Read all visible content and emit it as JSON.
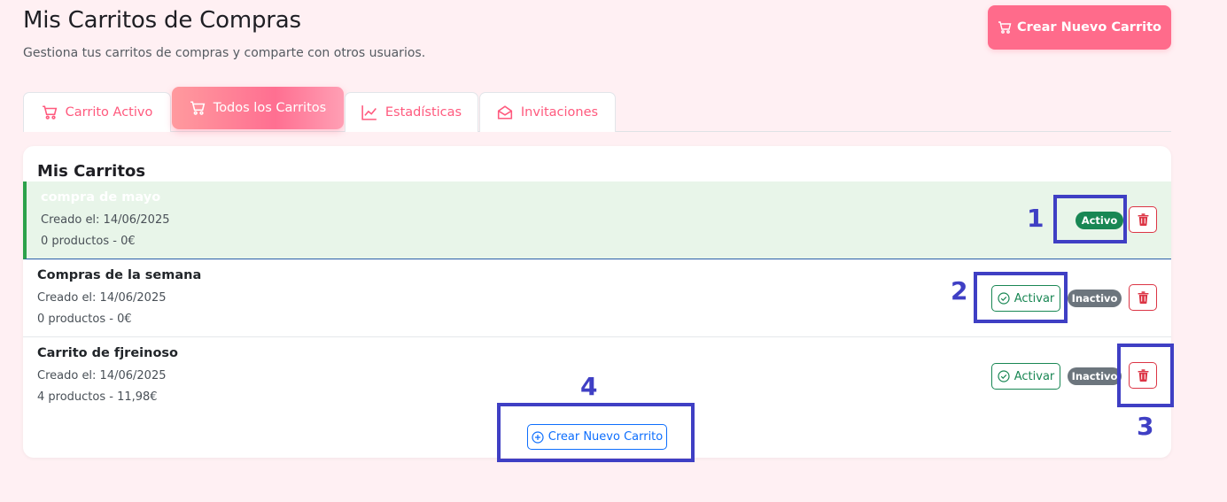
{
  "header": {
    "title": "Mis Carritos de Compras",
    "subtitle": "Gestiona tus carritos de compras y comparte con otros usuarios.",
    "create_button": "Crear Nuevo Carrito"
  },
  "tabs": [
    {
      "label": "Carrito Activo",
      "icon": "cart-icon"
    },
    {
      "label": "Todos los Carritos",
      "icon": "cart-icon",
      "active": true
    },
    {
      "label": "Estadísticas",
      "icon": "chart-line-icon"
    },
    {
      "label": "Invitaciones",
      "icon": "envelope-icon"
    }
  ],
  "card": {
    "title": "Mis Carritos",
    "carts": [
      {
        "name": "compra de mayo",
        "created": "Creado el: 14/06/2025",
        "summary": "0 productos - 0€",
        "status": "Activo",
        "is_active": true
      },
      {
        "name": "Compras de la semana",
        "created": "Creado el: 14/06/2025",
        "summary": "0 productos - 0€",
        "status": "Inactivo",
        "is_active": false,
        "activate_label": "Activar"
      },
      {
        "name": "Carrito de fjreinoso",
        "created": "Creado el: 14/06/2025",
        "summary": "4 productos - 11,98€",
        "status": "Inactivo",
        "is_active": false,
        "activate_label": "Activar"
      }
    ],
    "create_button": "Crear Nuevo Carrito"
  },
  "annotations": [
    "1",
    "2",
    "3",
    "4"
  ],
  "colors": {
    "accent": "#ff6b8b",
    "active_badge": "#198754",
    "inactive_badge": "#6c757d",
    "delete": "#dc3545",
    "primary_outline": "#0d6efd",
    "annotation": "#3f3fc4"
  }
}
